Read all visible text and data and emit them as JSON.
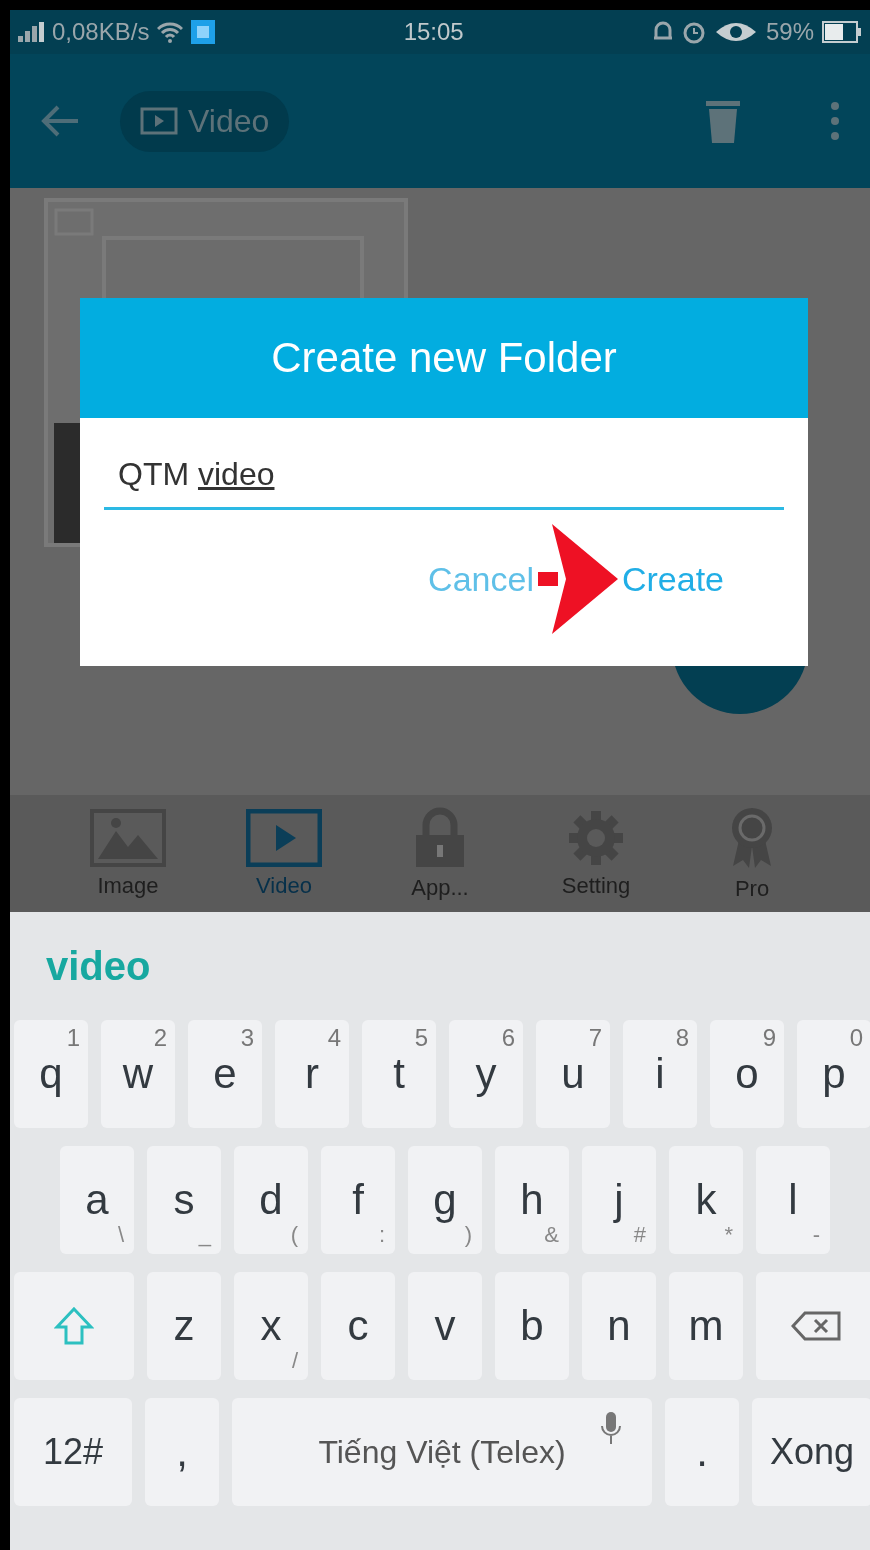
{
  "status_bar": {
    "speed": "0,08KB/s",
    "time": "15:05",
    "battery": "59%"
  },
  "app_bar": {
    "title": "Video"
  },
  "dialog": {
    "title": "Create new Folder",
    "input_prefix": "QTM ",
    "input_word": "video",
    "buttons": [
      {
        "label": "Cancel",
        "kind": "secondary"
      },
      {
        "label": "Create",
        "kind": "primary"
      }
    ]
  },
  "bottom_nav": [
    {
      "label": "Image",
      "selected": false
    },
    {
      "label": "Video",
      "selected": true
    },
    {
      "label": "App...",
      "selected": false
    },
    {
      "label": "Setting",
      "selected": false
    },
    {
      "label": "Pro",
      "selected": false
    }
  ],
  "keyboard": {
    "suggestion": "video",
    "rows": [
      [
        {
          "key": "q",
          "hint": "1"
        },
        {
          "key": "w",
          "hint": "2"
        },
        {
          "key": "e",
          "hint": "3"
        },
        {
          "key": "r",
          "hint": "4"
        },
        {
          "key": "t",
          "hint": "5"
        },
        {
          "key": "y",
          "hint": "6"
        },
        {
          "key": "u",
          "hint": "7"
        },
        {
          "key": "i",
          "hint": "8"
        },
        {
          "key": "o",
          "hint": "9"
        },
        {
          "key": "p",
          "hint": "0"
        }
      ],
      [
        {
          "key": "a",
          "sub": "\\"
        },
        {
          "key": "s",
          "sub": "_"
        },
        {
          "key": "d",
          "sub": "("
        },
        {
          "key": "f",
          "sub": ":"
        },
        {
          "key": "g",
          "sub": ")"
        },
        {
          "key": "h",
          "sub": "&"
        },
        {
          "key": "j",
          "sub": "#"
        },
        {
          "key": "k",
          "sub": "*"
        },
        {
          "key": "l",
          "sub": "-"
        }
      ],
      [
        {
          "key": "z"
        },
        {
          "key": "x",
          "sub": "/"
        },
        {
          "key": "c"
        },
        {
          "key": "v"
        },
        {
          "key": "b"
        },
        {
          "key": "n"
        },
        {
          "key": "m"
        }
      ]
    ],
    "bottom": {
      "numbers": "12#",
      "comma": ",",
      "space": "Tiếng Việt (Telex)",
      "period": ".",
      "done": "Xong"
    }
  }
}
